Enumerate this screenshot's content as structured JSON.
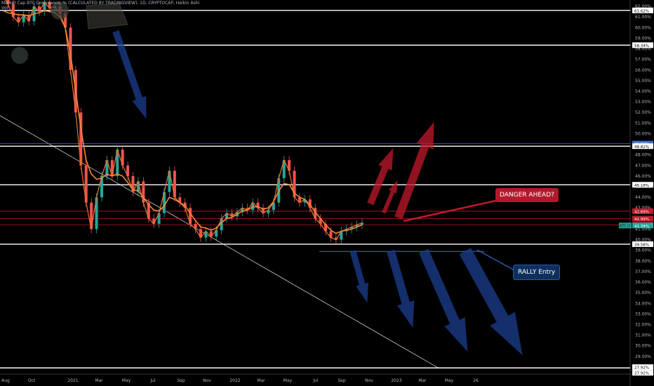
{
  "header": {
    "symbol_line": "Market Cap BTC Dominance, % (CALCULATED BY TRADINGVIEW), 1D, CRYPTOCAP, Heikin Ashi",
    "sub_line": "Vol"
  },
  "annotations": {
    "danger": "DANGER AHEAD?",
    "rally": "RALLY Entry"
  },
  "colors": {
    "background": "#000000",
    "candle_up": "#26a69a",
    "candle_down": "#ef5350",
    "ma_fast": "#e8742b",
    "ma_slow": "#f08a38",
    "level_line": "#ffffff",
    "blue_level": "#3b6fc9",
    "red_level": "#c2182c",
    "arrow_red": "#c2182c",
    "arrow_blue": "#1b3f8f"
  },
  "chart_data": {
    "type": "line",
    "title": "Market Cap BTC Dominance, % (CALCULATED BY TRADINGVIEW), 1D, CRYPTOCAP, Heikin Ashi",
    "ylabel": "",
    "xlabel": "",
    "ylim": [
      27.4,
      62.6
    ],
    "x": [
      "Aug",
      "Oct",
      "2021",
      "Mar",
      "May",
      "Jul",
      "Sep",
      "Nov",
      "2022",
      "Mar",
      "May",
      "Jul",
      "Sep",
      "Nov",
      "2023",
      "Mar",
      "May",
      "26"
    ],
    "y_ticks": [
      28,
      29,
      30,
      31,
      32,
      33,
      34,
      35,
      36,
      37,
      38,
      39,
      40,
      41,
      42,
      43,
      44,
      45,
      46,
      47,
      48,
      49,
      50,
      51,
      52,
      53,
      54,
      55,
      56,
      57,
      58,
      59,
      60,
      61,
      62
    ],
    "y_tick_labels": [
      "28.00%",
      "29.00%",
      "30.00%",
      "31.00%",
      "32.00%",
      "33.00%",
      "34.00%",
      "35.00%",
      "36.00%",
      "37.00%",
      "38.00%",
      "39.00%",
      "40.00%",
      "41.00%",
      "42.00%",
      "43.00%",
      "44.00%",
      "45.00%",
      "46.00%",
      "47.00%",
      "48.00%",
      "49.00%",
      "50.00%",
      "51.00%",
      "52.00%",
      "53.00%",
      "54.00%",
      "55.00%",
      "56.00%",
      "57.00%",
      "58.00%",
      "59.00%",
      "60.00%",
      "61.00%",
      "62.00%"
    ],
    "series": [
      {
        "values": [
          63.0,
          62.2,
          61.0,
          60.5,
          61.2,
          60.6,
          62.0,
          61.5,
          62.4,
          61.8,
          62.0,
          61.3,
          60.0,
          56.0,
          52.0,
          47.0,
          43.5,
          41.0,
          44.0,
          46.0,
          47.5,
          46.0,
          48.5,
          47.0,
          46.0,
          44.5,
          45.5,
          43.5,
          42.0,
          41.5,
          42.5,
          44.5,
          46.5,
          44.0,
          43.5,
          43.0,
          41.5,
          41.0,
          40.2,
          40.8,
          40.3,
          40.9,
          42.0,
          42.5,
          42.2,
          42.6,
          43.0,
          42.8,
          43.5,
          43.0,
          42.5,
          42.8,
          43.5,
          45.8,
          47.5,
          46.5,
          44.0,
          43.5,
          43.8,
          43.0,
          42.0,
          41.5,
          40.8,
          40.2,
          40.0,
          40.8,
          41.0,
          41.2,
          41.4,
          41.6
        ]
      },
      {
        "values": [
          61.6,
          61.4,
          61.3,
          61.2,
          61.2,
          61.1,
          61.3,
          61.4,
          61.6,
          61.5,
          61.4,
          61.0,
          60.0,
          57.5,
          54.0,
          50.5,
          47.5,
          46.2,
          45.7,
          45.8,
          46.2,
          46.0,
          46.2,
          46.0,
          45.4,
          44.7,
          44.6,
          44.0,
          43.3,
          42.8,
          42.7,
          43.2,
          44.0,
          43.8,
          43.5,
          43.2,
          42.5,
          41.8,
          41.2,
          41.1,
          40.9,
          41.1,
          41.6,
          42.0,
          42.1,
          42.4,
          42.7,
          42.8,
          43.1,
          43.1,
          42.9,
          43.0,
          43.6,
          44.6,
          45.3,
          45.2,
          44.4,
          44.0,
          43.8,
          43.3,
          42.6,
          42.0,
          41.4,
          40.9,
          40.6,
          40.8,
          40.9,
          41.0,
          41.2,
          41.4
        ]
      }
    ],
    "levels": [
      {
        "label": "61.62%",
        "value": 61.62,
        "color": "#ffffff"
      },
      {
        "label": "58.34%",
        "value": 58.34,
        "color": "#ffffff"
      },
      {
        "label": "49.06%",
        "value": 49.06,
        "color": "#3b6fc9"
      },
      {
        "label": "48.82%",
        "value": 48.82,
        "color": "#ffffff"
      },
      {
        "label": "45.18%",
        "value": 45.18,
        "color": "#ffffff"
      },
      {
        "label": "42.69%",
        "value": 42.69,
        "color": "#c2182c"
      },
      {
        "label": "41.99%",
        "value": 41.99,
        "color": "#c2182c"
      },
      {
        "label": "41.41%",
        "value": 41.41,
        "color": "#c2182c"
      },
      {
        "label": "39.58%",
        "value": 39.58,
        "color": "#ffffff"
      },
      {
        "label": "27.92%",
        "value": 27.92,
        "color": "#ffffff"
      },
      {
        "label": "27.92%",
        "value": 27.92,
        "color": "#ffffff"
      }
    ],
    "price_tag": {
      "label": "41.34%",
      "prefix": "BTC.D",
      "value": 41.34
    }
  }
}
